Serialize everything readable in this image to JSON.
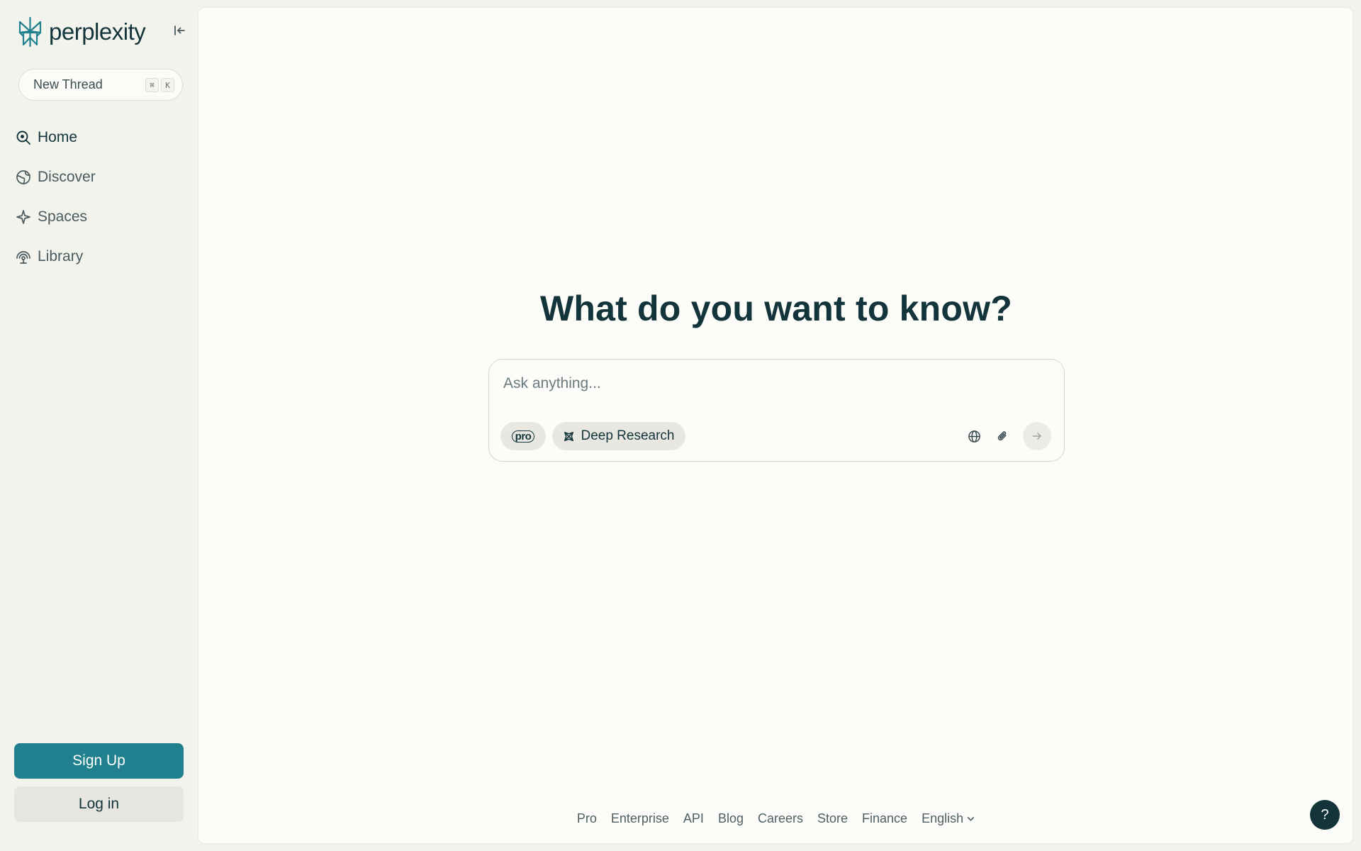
{
  "sidebar": {
    "brand": "perplexity",
    "new_thread": {
      "label": "New Thread",
      "keys": [
        "⌘",
        "K"
      ]
    },
    "items": [
      {
        "label": "Home",
        "icon": "search-icon",
        "active": true
      },
      {
        "label": "Discover",
        "icon": "globe-icon",
        "active": false
      },
      {
        "label": "Spaces",
        "icon": "sparkle-icon",
        "active": false
      },
      {
        "label": "Library",
        "icon": "library-icon",
        "active": false
      }
    ],
    "sign_up": "Sign Up",
    "log_in": "Log in"
  },
  "main": {
    "title": "What do you want to know?",
    "search": {
      "placeholder": "Ask anything...",
      "pro_label": "pro",
      "deep_research_label": "Deep Research"
    }
  },
  "footer": {
    "links": [
      "Pro",
      "Enterprise",
      "API",
      "Blog",
      "Careers",
      "Store",
      "Finance"
    ],
    "language": "English"
  },
  "help": "?",
  "colors": {
    "accent": "#21808d",
    "text": "#13343b",
    "sidebar_bg": "#f3f3ee",
    "main_bg": "#fcfcf9"
  }
}
